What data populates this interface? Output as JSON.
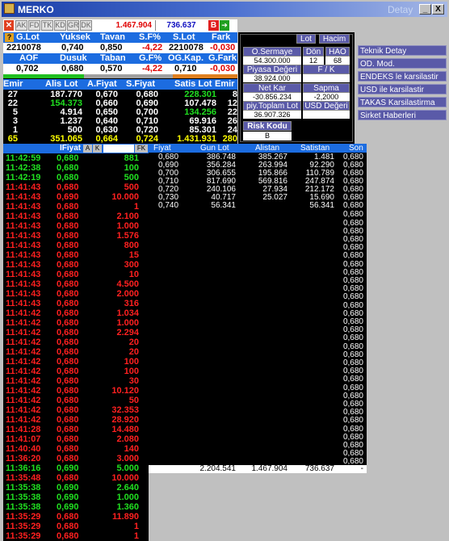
{
  "window": {
    "title": "MERKO",
    "detail_label": "Detay",
    "minimize": "_",
    "close": "X"
  },
  "toolbar": {
    "buttons": [
      "AK",
      "FD",
      "TK",
      "KD",
      "GR",
      "DK"
    ],
    "price1": "1.467.904",
    "price2": "736.637",
    "b_label": "B"
  },
  "row1": {
    "headers": [
      "G.Lot",
      "Yuksek",
      "Tavan",
      "S.F%",
      "S.Lot",
      "Fark"
    ],
    "values": [
      "2210078",
      "0,740",
      "0,850",
      "-4,22",
      "2210078",
      "-0,030"
    ]
  },
  "row2": {
    "headers": [
      "AOF",
      "Dusuk",
      "Taban",
      "G.F%",
      "OG.Kap.",
      "G.Fark"
    ],
    "values": [
      "0,702",
      "0,680",
      "0,570",
      "-4,22",
      "0,710",
      "-0,030"
    ]
  },
  "orders": {
    "headers": [
      "Emir",
      "Alis Lot",
      "A.Fiyat",
      "S.Fiyat",
      "Satis Lot",
      "Emir"
    ],
    "rows": [
      [
        "27",
        "187.770",
        "0,670",
        "0,680",
        "228.301",
        "8"
      ],
      [
        "22",
        "154.373",
        "0,660",
        "0,690",
        "107.478",
        "12"
      ],
      [
        "5",
        "4.914",
        "0,650",
        "0,700",
        "134.256",
        "22"
      ],
      [
        "3",
        "1.237",
        "0,640",
        "0,710",
        "69.916",
        "26"
      ],
      [
        "1",
        "500",
        "0,630",
        "0,720",
        "85.301",
        "24"
      ],
      [
        "65",
        "351.065",
        "0,664",
        "0,724",
        "1.431.931",
        "280"
      ]
    ]
  },
  "panel": {
    "lot_btn": "Lot",
    "hacim_btn": "Hacim",
    "osermaye_label": "O.Sermaye",
    "osermaye_value": "54.300.000",
    "don_label": "Dön",
    "don_value": "12",
    "hao_label": "HAO",
    "hao_value": "68",
    "piyasa_label": "Piyasa Değeri",
    "piyasa_value": "38.924.000",
    "fk_label": "F / K",
    "fk_value": "",
    "netkar_label": "Net Kar",
    "netkar_value": "-30.856.234",
    "sapma_label": "Sapma",
    "sapma_value": "-2,2000",
    "toplam_label": "piy.Toplam Lot",
    "toplam_value": "36.907.326",
    "usd_label": "USD Değeri",
    "usd_value": "",
    "risk_label": "Risk Kodu",
    "risk_value": "B"
  },
  "right_buttons": [
    "Teknik Detay",
    "OD. Mod.",
    "ENDEKS le karsilastir",
    "USD ile karsilastir",
    "TAKAS Karsilastirma",
    "Sirket Haberleri"
  ],
  "trades": {
    "headers": {
      "fiyat": "IFiyat",
      "a": "A",
      "k": "K",
      "fk": "FK"
    },
    "rows": [
      {
        "t": "11:42:59",
        "p": "0,680",
        "q": "881",
        "c": "g"
      },
      {
        "t": "11:42:38",
        "p": "0,680",
        "q": "100",
        "c": "g"
      },
      {
        "t": "11:42:19",
        "p": "0,680",
        "q": "500",
        "c": "g"
      },
      {
        "t": "11:41:43",
        "p": "0,680",
        "q": "500",
        "c": "r"
      },
      {
        "t": "11:41:43",
        "p": "0,690",
        "q": "10.000",
        "c": "r"
      },
      {
        "t": "11:41:43",
        "p": "0,680",
        "q": "1",
        "c": "r"
      },
      {
        "t": "11:41:43",
        "p": "0,680",
        "q": "2.100",
        "c": "r"
      },
      {
        "t": "11:41:43",
        "p": "0,680",
        "q": "1.000",
        "c": "r"
      },
      {
        "t": "11:41:43",
        "p": "0,680",
        "q": "1.576",
        "c": "r"
      },
      {
        "t": "11:41:43",
        "p": "0,680",
        "q": "800",
        "c": "r"
      },
      {
        "t": "11:41:43",
        "p": "0,680",
        "q": "15",
        "c": "r"
      },
      {
        "t": "11:41:43",
        "p": "0,680",
        "q": "300",
        "c": "r"
      },
      {
        "t": "11:41:43",
        "p": "0,680",
        "q": "10",
        "c": "r"
      },
      {
        "t": "11:41:43",
        "p": "0,680",
        "q": "4.500",
        "c": "r"
      },
      {
        "t": "11:41:43",
        "p": "0,680",
        "q": "2.000",
        "c": "r"
      },
      {
        "t": "11:41:43",
        "p": "0,680",
        "q": "316",
        "c": "r"
      },
      {
        "t": "11:41:42",
        "p": "0,680",
        "q": "1.034",
        "c": "r"
      },
      {
        "t": "11:41:42",
        "p": "0,680",
        "q": "1.000",
        "c": "r"
      },
      {
        "t": "11:41:42",
        "p": "0,680",
        "q": "2.294",
        "c": "r"
      },
      {
        "t": "11:41:42",
        "p": "0,680",
        "q": "20",
        "c": "r"
      },
      {
        "t": "11:41:42",
        "p": "0,680",
        "q": "20",
        "c": "r"
      },
      {
        "t": "11:41:42",
        "p": "0,680",
        "q": "100",
        "c": "r"
      },
      {
        "t": "11:41:42",
        "p": "0,680",
        "q": "100",
        "c": "r"
      },
      {
        "t": "11:41:42",
        "p": "0,680",
        "q": "30",
        "c": "r"
      },
      {
        "t": "11:41:42",
        "p": "0,680",
        "q": "10.120",
        "c": "r"
      },
      {
        "t": "11:41:42",
        "p": "0,680",
        "q": "50",
        "c": "r"
      },
      {
        "t": "11:41:42",
        "p": "0,680",
        "q": "32.353",
        "c": "r"
      },
      {
        "t": "11:41:42",
        "p": "0,680",
        "q": "28.920",
        "c": "r"
      },
      {
        "t": "11:41:28",
        "p": "0,680",
        "q": "14.480",
        "c": "r"
      },
      {
        "t": "11:41:07",
        "p": "0,680",
        "q": "2.080",
        "c": "r"
      },
      {
        "t": "11:40:40",
        "p": "0,680",
        "q": "140",
        "c": "r"
      },
      {
        "t": "11:36:20",
        "p": "0,680",
        "q": "3.000",
        "c": "r"
      },
      {
        "t": "11:36:16",
        "p": "0,690",
        "q": "5.000",
        "c": "g"
      },
      {
        "t": "11:35:48",
        "p": "0,680",
        "q": "10.000",
        "c": "r"
      },
      {
        "t": "11:35:38",
        "p": "0,690",
        "q": "2.640",
        "c": "g"
      },
      {
        "t": "11:35:38",
        "p": "0,690",
        "q": "1.000",
        "c": "g"
      },
      {
        "t": "11:35:38",
        "p": "0,690",
        "q": "1.360",
        "c": "g"
      },
      {
        "t": "11:35:29",
        "p": "0,680",
        "q": "11.890",
        "c": "r"
      },
      {
        "t": "11:35:29",
        "p": "0,680",
        "q": "1",
        "c": "r"
      },
      {
        "t": "11:35:29",
        "p": "0,680",
        "q": "1",
        "c": "r"
      }
    ]
  },
  "depth": {
    "headers": [
      "Fiyat",
      "Gun Lot",
      "Alistan",
      "Satistan",
      "Son"
    ],
    "rows": [
      [
        "0,680",
        "386.748",
        "385.267",
        "1.481",
        "0,680"
      ],
      [
        "0,690",
        "356.284",
        "263.994",
        "92.290",
        "0,680"
      ],
      [
        "0,700",
        "306.655",
        "195.866",
        "110.789",
        "0,680"
      ],
      [
        "0,710",
        "817.690",
        "569.816",
        "247.874",
        "0,680"
      ],
      [
        "0,720",
        "240.106",
        "27.934",
        "212.172",
        "0,680"
      ],
      [
        "0,730",
        "40.717",
        "25.027",
        "15.690",
        "0,680"
      ],
      [
        "0,740",
        "56.341",
        "",
        "56.341",
        "0,680"
      ]
    ],
    "son_extra": "0,680",
    "totals": [
      "2.204.541",
      "1.467.904",
      "736.637",
      "-"
    ]
  },
  "colors": {
    "green": "#20e020",
    "red": "#ff2020",
    "yellow": "#ffff00",
    "blue": "#1c6ce0",
    "button": "#5a5aa8"
  }
}
